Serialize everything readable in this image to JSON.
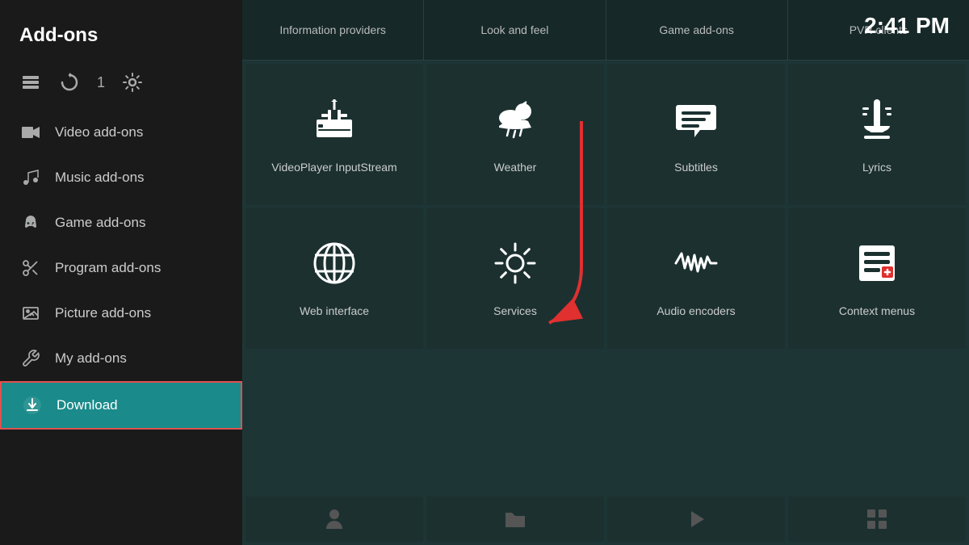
{
  "sidebar": {
    "title": "Add-ons",
    "icons": [
      {
        "name": "layers-icon",
        "symbol": "⬡",
        "label": ""
      },
      {
        "name": "refresh-icon",
        "symbol": "↺",
        "label": ""
      },
      {
        "name": "badge",
        "symbol": "1",
        "label": "1"
      },
      {
        "name": "settings-icon",
        "symbol": "⚙",
        "label": ""
      }
    ],
    "nav_items": [
      {
        "id": "video-addons",
        "label": "Video add-ons",
        "icon": "🎞"
      },
      {
        "id": "music-addons",
        "label": "Music add-ons",
        "icon": "🎧"
      },
      {
        "id": "game-addons",
        "label": "Game add-ons",
        "icon": "🎮"
      },
      {
        "id": "program-addons",
        "label": "Program add-ons",
        "icon": "✂"
      },
      {
        "id": "picture-addons",
        "label": "Picture add-ons",
        "icon": "🖼"
      },
      {
        "id": "my-addons",
        "label": "My add-ons",
        "icon": "⚙"
      },
      {
        "id": "download",
        "label": "Download",
        "icon": "⬇",
        "active": true
      }
    ]
  },
  "clock": "2:41 PM",
  "top_tabs": [
    {
      "id": "info-providers",
      "label": "Information providers"
    },
    {
      "id": "look-feel",
      "label": "Look and feel"
    },
    {
      "id": "game-addons-tab",
      "label": "Game add-ons"
    },
    {
      "id": "pvr-clients",
      "label": "PVR clients"
    }
  ],
  "grid": [
    {
      "id": "videoplayer-inputstream",
      "label": "VideoPlayer InputStream"
    },
    {
      "id": "weather",
      "label": "Weather"
    },
    {
      "id": "subtitles",
      "label": "Subtitles"
    },
    {
      "id": "lyrics",
      "label": "Lyrics"
    },
    {
      "id": "web-interface",
      "label": "Web interface"
    },
    {
      "id": "services",
      "label": "Services"
    },
    {
      "id": "audio-encoders",
      "label": "Audio encoders"
    },
    {
      "id": "context-menus",
      "label": "Context menus"
    }
  ],
  "bottom_partial": [
    {
      "id": "bottom-1",
      "icon": "person"
    },
    {
      "id": "bottom-2",
      "icon": "folder"
    },
    {
      "id": "bottom-3",
      "icon": "play"
    },
    {
      "id": "bottom-4",
      "icon": "grid"
    }
  ]
}
